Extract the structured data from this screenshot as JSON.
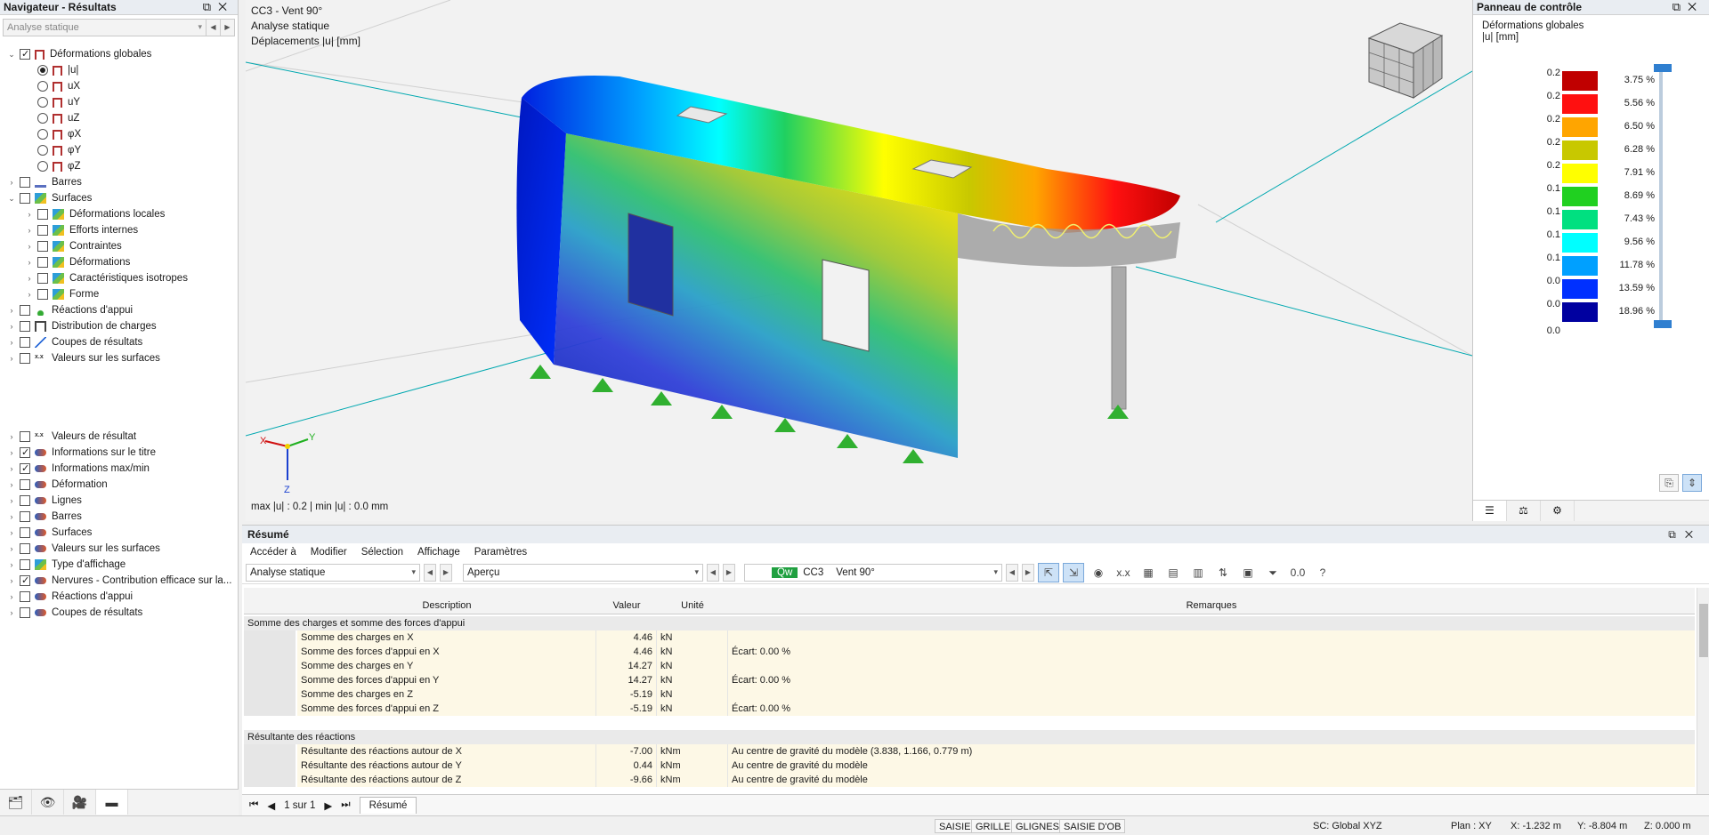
{
  "navigator": {
    "title": "Navigateur - Résultats",
    "window_buttons": [
      "⧉",
      "✕"
    ],
    "combo": "Analyse statique",
    "tree": [
      {
        "label": "Déformations globales",
        "checked": true,
        "level": 0,
        "expanded": true,
        "icon": "frame-icon"
      },
      {
        "label": "|u|",
        "radio": true,
        "selected": true,
        "level": 1,
        "icon": "frame-icon"
      },
      {
        "label": "uX",
        "radio": true,
        "level": 1,
        "icon": "frame-icon"
      },
      {
        "label": "uY",
        "radio": true,
        "level": 1,
        "icon": "frame-icon"
      },
      {
        "label": "uZ",
        "radio": true,
        "level": 1,
        "icon": "frame-icon"
      },
      {
        "label": "φX",
        "radio": true,
        "level": 1,
        "icon": "frame-icon"
      },
      {
        "label": "φY",
        "radio": true,
        "level": 1,
        "icon": "frame-icon"
      },
      {
        "label": "φZ",
        "radio": true,
        "level": 1,
        "icon": "frame-icon"
      },
      {
        "label": "Barres",
        "level": 0,
        "icon": "bar-icon"
      },
      {
        "label": "Surfaces",
        "level": 0,
        "expanded": true,
        "icon": "surface-icon"
      },
      {
        "label": "Déformations locales",
        "level": 1,
        "icon": "surface-icon"
      },
      {
        "label": "Efforts internes",
        "level": 1,
        "icon": "surface-icon"
      },
      {
        "label": "Contraintes",
        "level": 1,
        "icon": "surface-icon"
      },
      {
        "label": "Déformations",
        "level": 1,
        "icon": "surface-icon"
      },
      {
        "label": "Caractéristiques isotropes",
        "level": 1,
        "icon": "surface-icon"
      },
      {
        "label": "Forme",
        "level": 1,
        "icon": "surface-icon"
      },
      {
        "label": "Réactions d'appui",
        "level": 0,
        "icon": "support-icon"
      },
      {
        "label": "Distribution de charges",
        "level": 0,
        "icon": "distribution-icon"
      },
      {
        "label": "Coupes de résultats",
        "level": 0,
        "icon": "cut-icon"
      },
      {
        "label": "Valeurs sur les surfaces",
        "level": 0,
        "icon": "values-icon"
      }
    ],
    "tree2": [
      {
        "label": "Valeurs de résultat",
        "checked": false,
        "icon": "values-icon"
      },
      {
        "label": "Informations sur le titre",
        "checked": true,
        "icon": "info-icon"
      },
      {
        "label": "Informations max/min",
        "checked": true,
        "icon": "info-icon"
      },
      {
        "label": "Déformation",
        "checked": false,
        "icon": "info-icon"
      },
      {
        "label": "Lignes",
        "checked": false,
        "icon": "info-icon"
      },
      {
        "label": "Barres",
        "checked": false,
        "icon": "info-icon"
      },
      {
        "label": "Surfaces",
        "checked": false,
        "icon": "info-icon"
      },
      {
        "label": "Valeurs sur les surfaces",
        "checked": false,
        "icon": "info-icon"
      },
      {
        "label": "Type d'affichage",
        "checked": false,
        "icon": "surface-icon"
      },
      {
        "label": "Nervures - Contribution efficace sur la...",
        "checked": true,
        "icon": "info-icon"
      },
      {
        "label": "Réactions d'appui",
        "checked": false,
        "icon": "info-icon"
      },
      {
        "label": "Coupes de résultats",
        "checked": false,
        "icon": "info-icon"
      }
    ]
  },
  "viewport": {
    "line1": "CC3 - Vent 90°",
    "line2": "Analyse statique",
    "line3": "Déplacements |u| [mm]",
    "footer": "max |u| : 0.2 | min |u| : 0.0 mm",
    "axis_x": "X",
    "axis_y": "Y",
    "axis_z": "Z"
  },
  "control_panel": {
    "title": "Panneau de contrôle",
    "subtitle": "Déformations globales",
    "unit": "|u| [mm]",
    "legend": [
      {
        "value": "0.2",
        "color": "#c00000",
        "percent": "3.75 %"
      },
      {
        "value": "0.2",
        "color": "#ff1010",
        "percent": "5.56 %"
      },
      {
        "value": "0.2",
        "color": "#ffa500",
        "percent": "6.50 %"
      },
      {
        "value": "0.2",
        "color": "#c8c800",
        "percent": "6.28 %"
      },
      {
        "value": "0.2",
        "color": "#ffff00",
        "percent": "7.91 %"
      },
      {
        "value": "0.1",
        "color": "#20d020",
        "percent": "8.69 %"
      },
      {
        "value": "0.1",
        "color": "#00e080",
        "percent": "7.43 %"
      },
      {
        "value": "0.1",
        "color": "#00ffff",
        "percent": "9.56 %"
      },
      {
        "value": "0.1",
        "color": "#00a0ff",
        "percent": "11.78 %"
      },
      {
        "value": "0.0",
        "color": "#0030ff",
        "percent": "13.59 %"
      },
      {
        "value": "0.0",
        "color": "#0000a0",
        "percent": "18.96 %"
      }
    ],
    "last_value": "0.0"
  },
  "results": {
    "title": "Résumé",
    "menu": [
      "Accéder à",
      "Modifier",
      "Sélection",
      "Affichage",
      "Paramètres"
    ],
    "combo1": "Analyse statique",
    "combo2": "Aperçu",
    "lc_badge": "Qw",
    "lc_code": "CC3",
    "lc_name": "Vent 90°",
    "columns": [
      "Description",
      "Valeur",
      "Unité",
      "Remarques"
    ],
    "groups": [
      {
        "title": "Somme des charges et somme des forces d'appui",
        "rows": [
          {
            "d": "Somme des charges en X",
            "v": "4.46",
            "u": "kN",
            "r": ""
          },
          {
            "d": "Somme des forces d'appui en X",
            "v": "4.46",
            "u": "kN",
            "r": "Écart: 0.00 %"
          },
          {
            "d": "Somme des charges en Y",
            "v": "14.27",
            "u": "kN",
            "r": ""
          },
          {
            "d": "Somme des forces d'appui en Y",
            "v": "14.27",
            "u": "kN",
            "r": "Écart: 0.00 %"
          },
          {
            "d": "Somme des charges en Z",
            "v": "-5.19",
            "u": "kN",
            "r": ""
          },
          {
            "d": "Somme des forces d'appui en Z",
            "v": "-5.19",
            "u": "kN",
            "r": "Écart: 0.00 %"
          }
        ]
      },
      {
        "title": "Résultante des réactions",
        "rows": [
          {
            "d": "Résultante des réactions autour de X",
            "v": "-7.00",
            "u": "kNm",
            "r": "Au centre de gravité du modèle (3.838, 1.166, 0.779 m)"
          },
          {
            "d": "Résultante des réactions autour de Y",
            "v": "0.44",
            "u": "kNm",
            "r": "Au centre de gravité du modèle"
          },
          {
            "d": "Résultante des réactions autour de Z",
            "v": "-9.66",
            "u": "kNm",
            "r": "Au centre de gravité du modèle"
          }
        ]
      }
    ],
    "pager": "1 sur 1",
    "tab": "Résumé"
  },
  "status": {
    "buttons": [
      "SAISIE",
      "GRILLE",
      "GLIGNES",
      "SAISIE D'OB"
    ],
    "cs": "SC: Global XYZ",
    "plan": "Plan : XY",
    "x": "X: -1.232 m",
    "y": "Y: -8.804 m",
    "z": "Z: 0.000 m"
  }
}
